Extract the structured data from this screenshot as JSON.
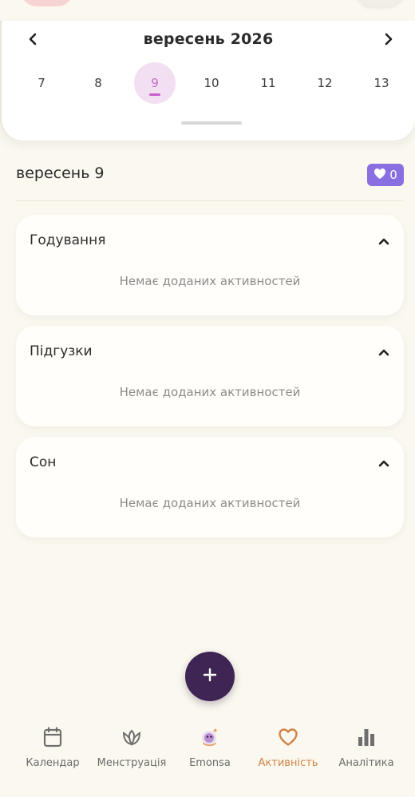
{
  "calendar": {
    "month_title": "вересень 2026",
    "days": [
      {
        "label": "7",
        "selected": false
      },
      {
        "label": "8",
        "selected": false
      },
      {
        "label": "9",
        "selected": true
      },
      {
        "label": "10",
        "selected": false
      },
      {
        "label": "11",
        "selected": false
      },
      {
        "label": "12",
        "selected": false
      },
      {
        "label": "13",
        "selected": false
      }
    ],
    "prev_icon": "chevron-left-icon",
    "next_icon": "chevron-right-icon"
  },
  "day_header": {
    "date_label": "вересень 9",
    "likes_count": "0",
    "likes_icon": "heart-icon"
  },
  "sections": [
    {
      "title": "Годування",
      "empty_text": "Немає доданих активностей"
    },
    {
      "title": "Підгузки",
      "empty_text": "Немає доданих активностей"
    },
    {
      "title": "Сон",
      "empty_text": "Немає доданих активностей"
    }
  ],
  "fab": {
    "icon": "plus-icon"
  },
  "bottom_nav": {
    "items": [
      {
        "label": "Календар",
        "icon": "calendar-icon",
        "active": false
      },
      {
        "label": "Менструація",
        "icon": "tulip-icon",
        "active": false
      },
      {
        "label": "Emonsa",
        "icon": "mascot-icon",
        "active": false
      },
      {
        "label": "Активність",
        "icon": "heart-outline-icon",
        "active": true
      },
      {
        "label": "Аналітика",
        "icon": "bar-chart-icon",
        "active": false
      }
    ]
  },
  "colors": {
    "background": "#fbf9ef",
    "selected_day_bg": "#f3dff2",
    "selected_day_text": "#c36ac7",
    "badge": "#8a6fe0",
    "fab": "#3e2553",
    "nav_active": "#d08248"
  }
}
